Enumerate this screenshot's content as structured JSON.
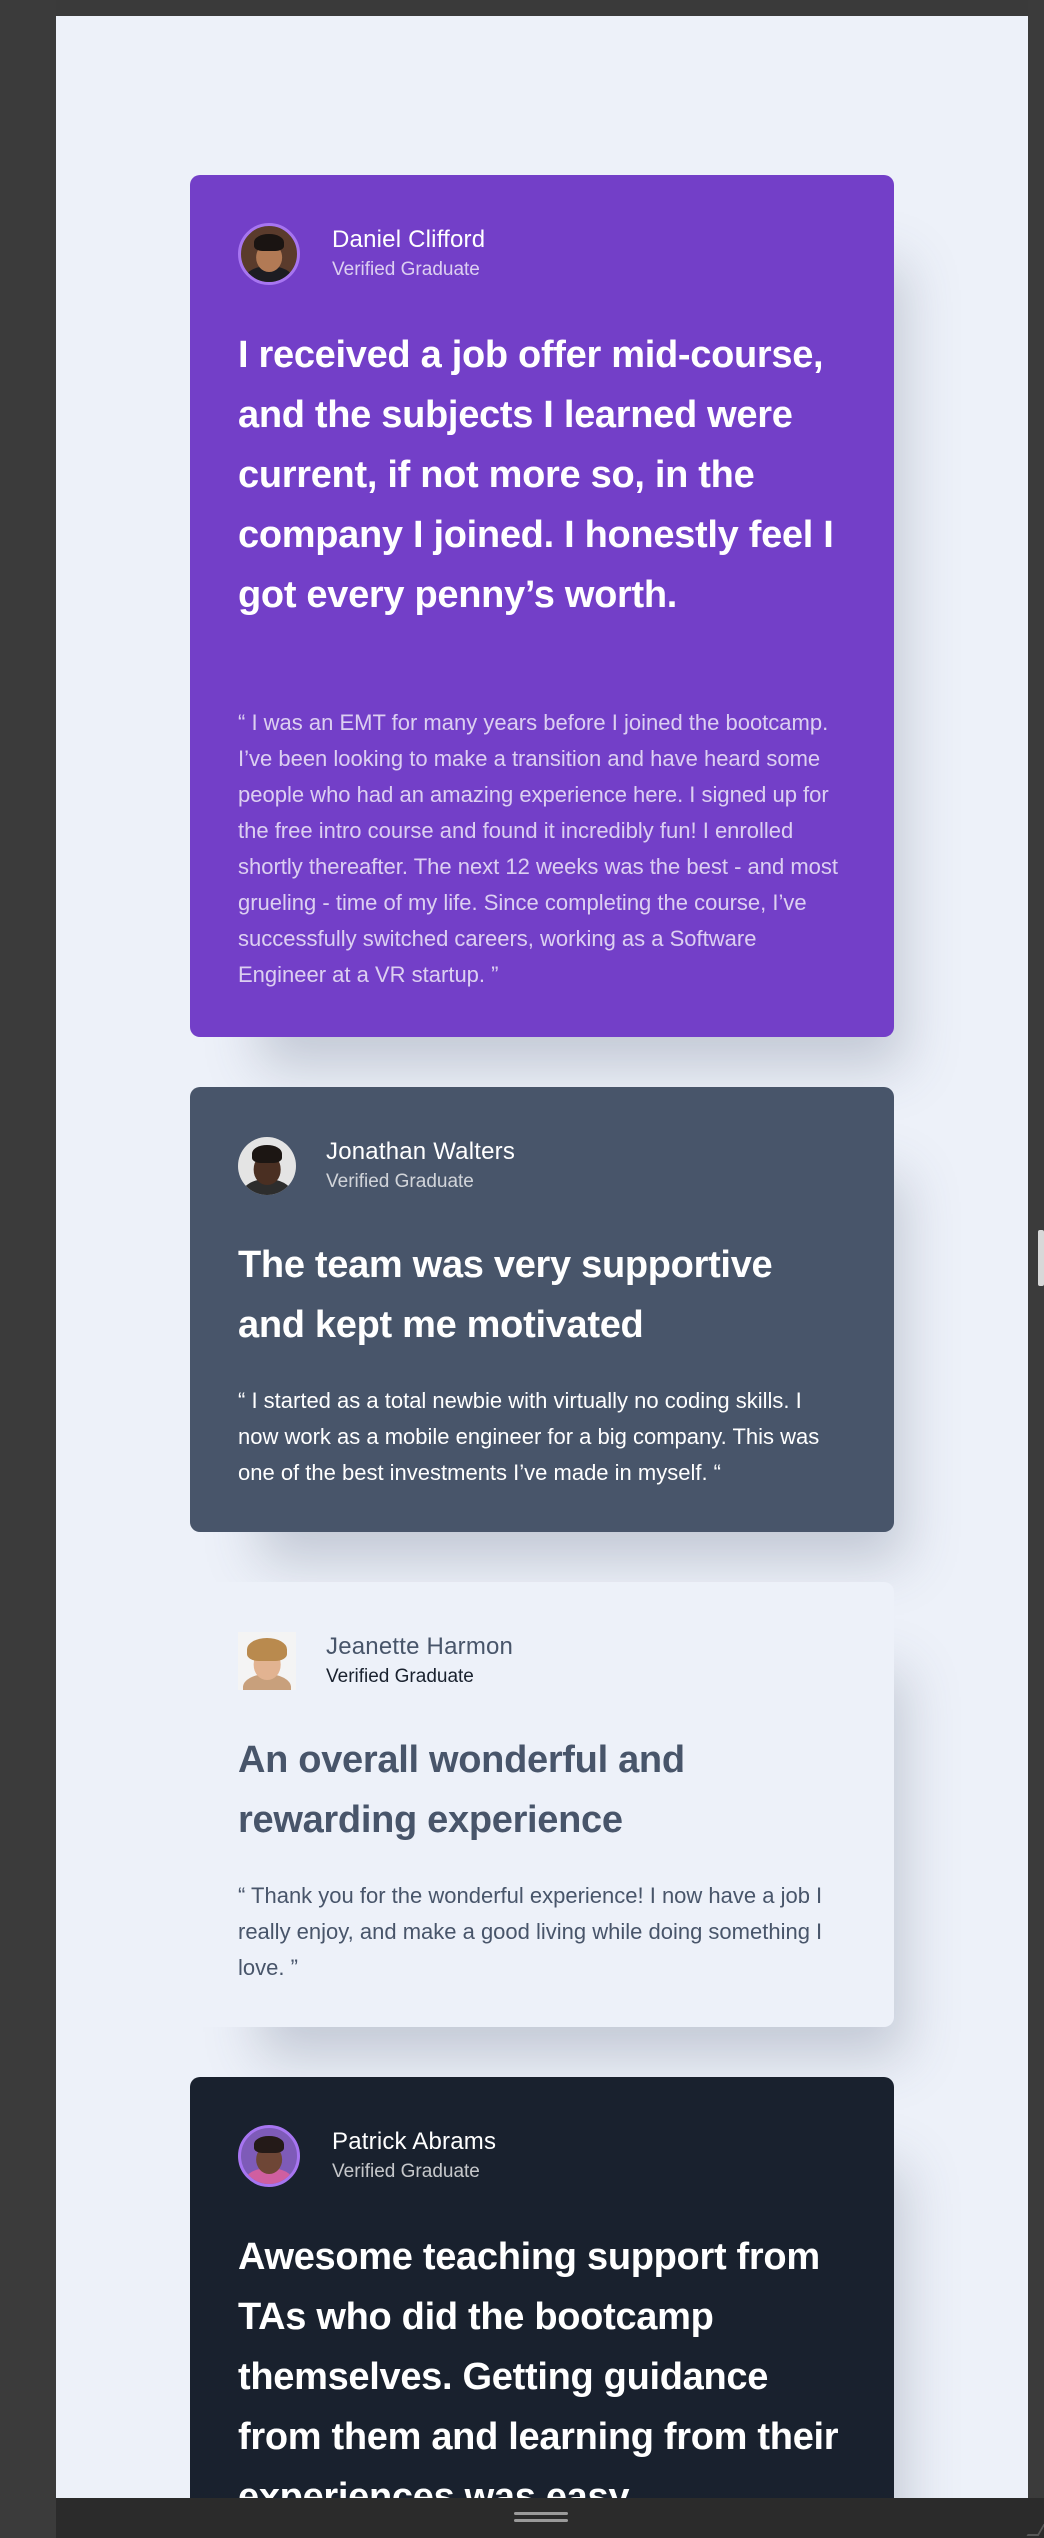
{
  "testimonials": [
    {
      "name": "Daniel Clifford",
      "role": "Verified Graduate",
      "headline": "I received a job offer mid-course, and the subjects I learned were current, if not more so, in the company I joined. I honestly feel I got every penny’s worth.",
      "quote": "“ I was an EMT for many years before I joined the bootcamp. I’ve been looking to make a transition and have heard some people who had an amazing experience here. I signed up for the free intro course and found it incredibly fun! I enrolled shortly thereafter. The next 12 weeks was the best - and most grueling - time of my life. Since completing the course, I’ve successfully switched careers, working as a Software Engineer at a VR startup. ”",
      "background": "#733fc8"
    },
    {
      "name": "Jonathan Walters",
      "role": "Verified Graduate",
      "headline": "The team was very supportive and kept me motivated",
      "quote": "“ I started as a total newbie with virtually no coding skills. I now work as a mobile engineer for a big company. This was one of the best investments I’ve made in myself. “",
      "background": "#48556a"
    },
    {
      "name": "Jeanette Harmon",
      "role": "Verified Graduate",
      "headline": "An overall wonderful and rewarding experience",
      "quote": "“ Thank you for the wonderful experience! I now have a job I really enjoy, and make a good living while doing something I love. ”",
      "background": "#edf1f9"
    },
    {
      "name": "Patrick Abrams",
      "role": "Verified Graduate",
      "headline": "Awesome teaching support from TAs who did the bootcamp themselves. Getting guidance from them and learning from their experiences was easy.",
      "background": "#19212e"
    }
  ],
  "colors": {
    "page_background": "#edf1f9",
    "avatar_ring": "#a775f1",
    "muted_text": "#48556a"
  }
}
